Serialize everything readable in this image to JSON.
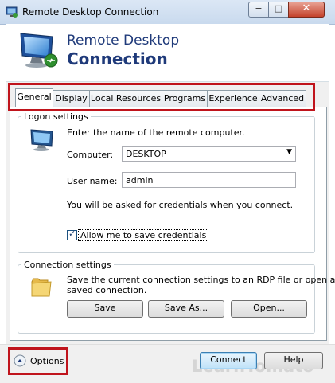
{
  "window": {
    "title": "Remote Desktop Connection",
    "close_glyph": "✕",
    "min_glyph": "−",
    "max_glyph": "□"
  },
  "banner": {
    "line1": "Remote Desktop",
    "line2": "Connection",
    "icon": "remote-desktop-monitor-icon"
  },
  "tabs": [
    {
      "label": "General",
      "active": true
    },
    {
      "label": "Display",
      "active": false
    },
    {
      "label": "Local Resources",
      "active": false
    },
    {
      "label": "Programs",
      "active": false
    },
    {
      "label": "Experience",
      "active": false
    },
    {
      "label": "Advanced",
      "active": false
    }
  ],
  "logon": {
    "group_label": "Logon settings",
    "instruction": "Enter the name of the remote computer.",
    "computer_label": "Computer:",
    "computer_value": "DESKTOP",
    "username_label": "User name:",
    "username_value": "admin",
    "credentials_note": "You will be asked for credentials when you connect.",
    "save_credentials_label": "Allow me to save credentials",
    "save_credentials_checked": true
  },
  "connection": {
    "group_label": "Connection settings",
    "description_line1": "Save the current connection settings to an RDP file or open a",
    "description_line2": "saved connection.",
    "save_label": "Save",
    "save_as_label": "Save As...",
    "open_label": "Open..."
  },
  "footer": {
    "options_label": "Options",
    "connect_label": "Connect",
    "help_label": "Help"
  },
  "watermark": "LearnTomato",
  "colors": {
    "banner_text": "#1f3a7a",
    "highlight_box": "#c0141c",
    "accent_button_border": "#3c7fb1"
  }
}
